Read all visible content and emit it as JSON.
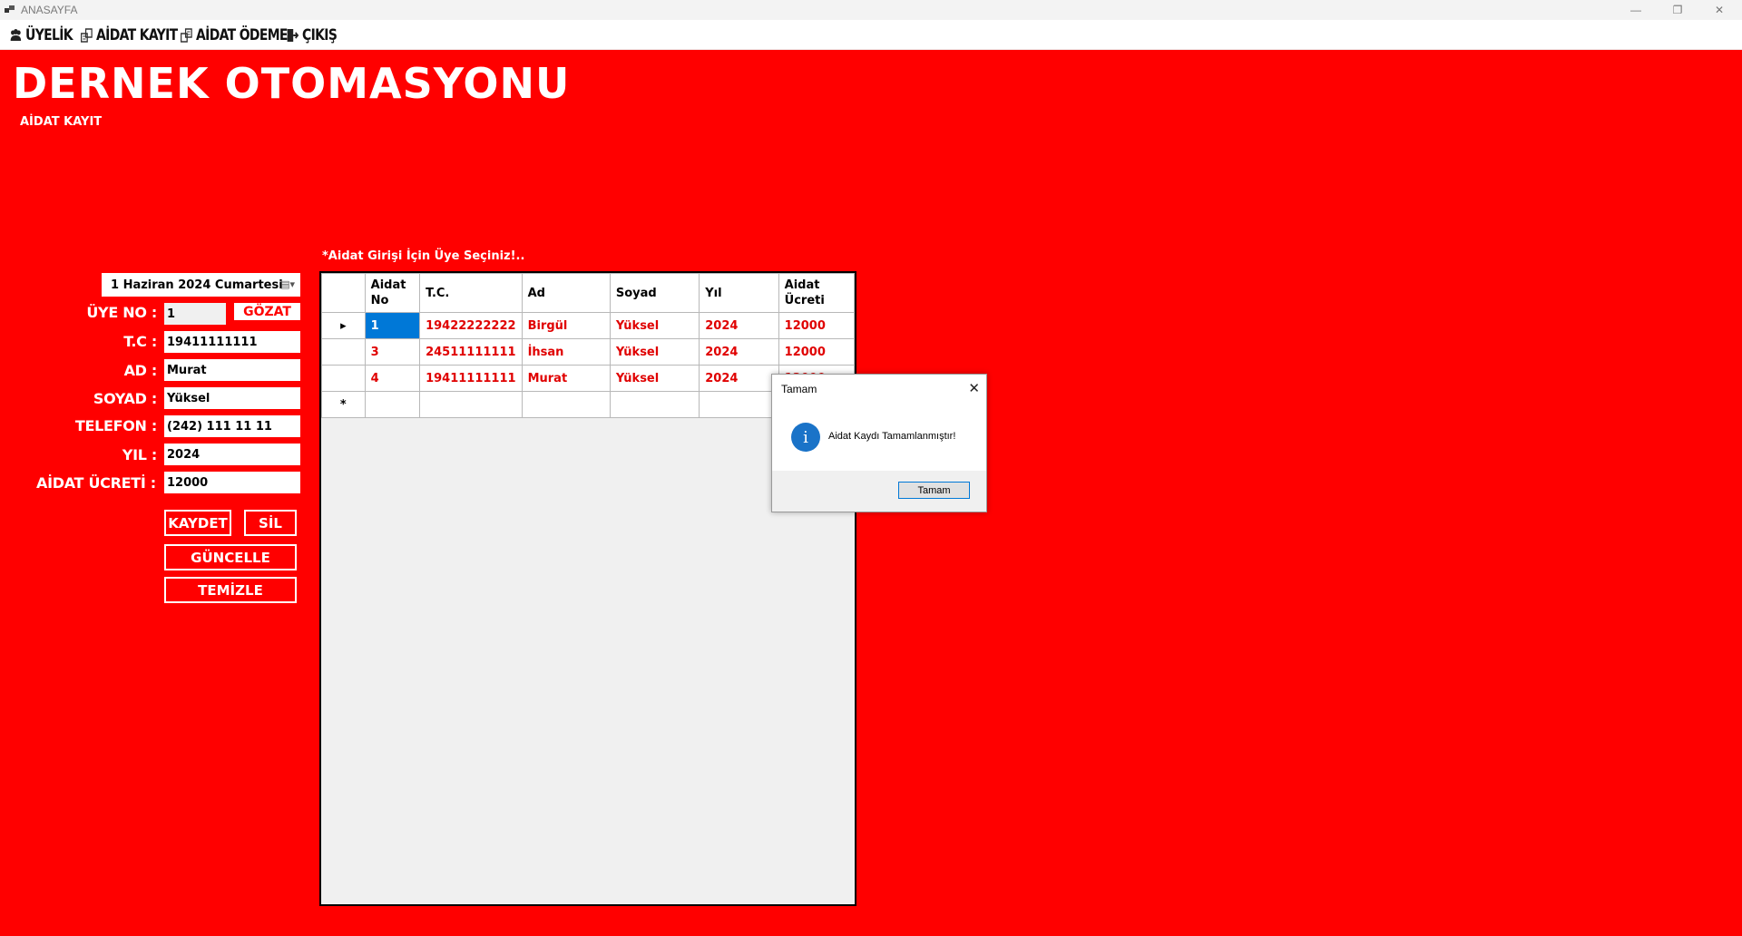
{
  "window": {
    "title": "ANASAYFA",
    "minimize": "—",
    "restore": "❐",
    "close": "✕"
  },
  "menu": [
    {
      "label": "ÜYELİK",
      "icon": "users-icon"
    },
    {
      "label": "AİDAT KAYIT",
      "icon": "register-icon"
    },
    {
      "label": "AİDAT ÖDEME",
      "icon": "payment-icon"
    },
    {
      "label": "ÇIKIŞ",
      "icon": "exit-icon"
    }
  ],
  "header": {
    "title": "DERNEK OTOMASYONU",
    "subtitle": "AİDAT KAYIT"
  },
  "hint": "*Aidat Girişi İçin Üye Seçiniz!..",
  "form": {
    "date": "1 Haziran 2024 Cumartesi",
    "labels": {
      "uye_no": "ÜYE NO :",
      "tc": "T.C :",
      "ad": "AD :",
      "soyad": "SOYAD :",
      "telefon": "TELEFON :",
      "yil": "YIL :",
      "aidat": "AİDAT ÜCRETİ :"
    },
    "values": {
      "uye_no": "1",
      "tc": "19411111111",
      "ad": "Murat",
      "soyad": "Yüksel",
      "telefon": "(242) 111 11 11",
      "yil": "2024",
      "aidat": "12000"
    },
    "buttons": {
      "gozat": "GÖZAT",
      "kaydet": "KAYDET",
      "sil": "SİL",
      "guncelle": "GÜNCELLE",
      "temizle": "TEMİZLE"
    }
  },
  "grid": {
    "columns": [
      "Aidat No",
      "T.C.",
      "Ad",
      "Soyad",
      "Yıl",
      "Aidat Ücreti"
    ],
    "rows": [
      [
        "1",
        "19422222222",
        "Birgül",
        "Yüksel",
        "2024",
        "12000"
      ],
      [
        "3",
        "24511111111",
        "İhsan",
        "Yüksel",
        "2024",
        "12000"
      ],
      [
        "4",
        "19411111111",
        "Murat",
        "Yüksel",
        "2024",
        "12000"
      ]
    ],
    "current_row_marker": "▸",
    "new_row_marker": "*"
  },
  "dialog": {
    "title": "Tamam",
    "close": "✕",
    "icon": "info-icon",
    "icon_glyph": "i",
    "message": "Aidat Kaydı Tamamlanmıştır!",
    "ok": "Tamam"
  }
}
